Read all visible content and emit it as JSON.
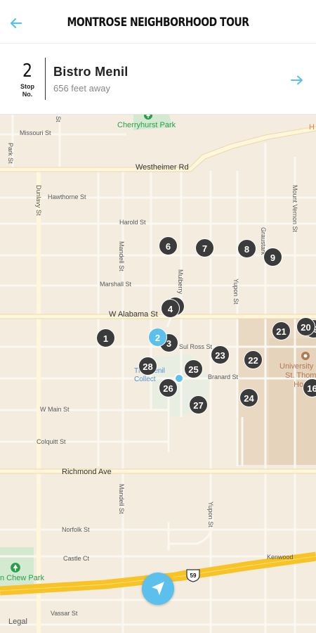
{
  "header": {
    "title": "MONTROSE NEIGHBORHOOD TOUR",
    "back_icon": "arrow-left-icon"
  },
  "stop": {
    "number": "2",
    "number_label": "Stop No.",
    "number_label_line1": "Stop",
    "number_label_line2": "No.",
    "name": "Bistro Menil",
    "distance": "656 feet away",
    "arrow_icon": "arrow-right-icon"
  },
  "map": {
    "streets": {
      "missouri": "Missouri St",
      "westheimer": "Westheimer Rd",
      "hawthorne": "Hawthorne St",
      "harold": "Harold St",
      "marshall": "Marshall St",
      "w_alabama": "W Alabama St",
      "sul_ross": "Sul Ross St",
      "branard": "Branard St",
      "w_main": "W Main St",
      "colquitt": "Colquitt St",
      "richmond": "Richmond Ave",
      "norfolk": "Norfolk St",
      "castle": "Castle Ct",
      "vassar": "Vassar St",
      "kenwood": "Kenwood",
      "dunlavy": "Dunlavy St",
      "park": "Park St",
      "mandell_n": "Mandell St",
      "mandell_s": "Mandell St",
      "mulberry": "Mulberry",
      "yupon_n": "Yupon St",
      "yupon_s": "Yupon St",
      "graustark": "Graustark",
      "mount_vernon": "Mount Vernon St",
      "hwy": "59"
    },
    "places": {
      "cherryhurst": "Cherryhurst Park",
      "chew_park": "n Chew Park",
      "university": "University of",
      "university_2": "St. Thom",
      "university_3": "Hou",
      "menil": "The Menil",
      "menil_2": "Collect",
      "h_label": "H"
    },
    "stops": [
      "1",
      "2",
      "4",
      "6",
      "7",
      "8",
      "9",
      "16",
      "20",
      "21",
      "22",
      "23",
      "24",
      "25",
      "26",
      "27",
      "28"
    ],
    "active_stop": "2",
    "legal": "Legal"
  },
  "colors": {
    "accent": "#5bc0ec",
    "marker": "#3b3b3b",
    "park": "#2a9d4c",
    "highway": "#f7c326"
  }
}
